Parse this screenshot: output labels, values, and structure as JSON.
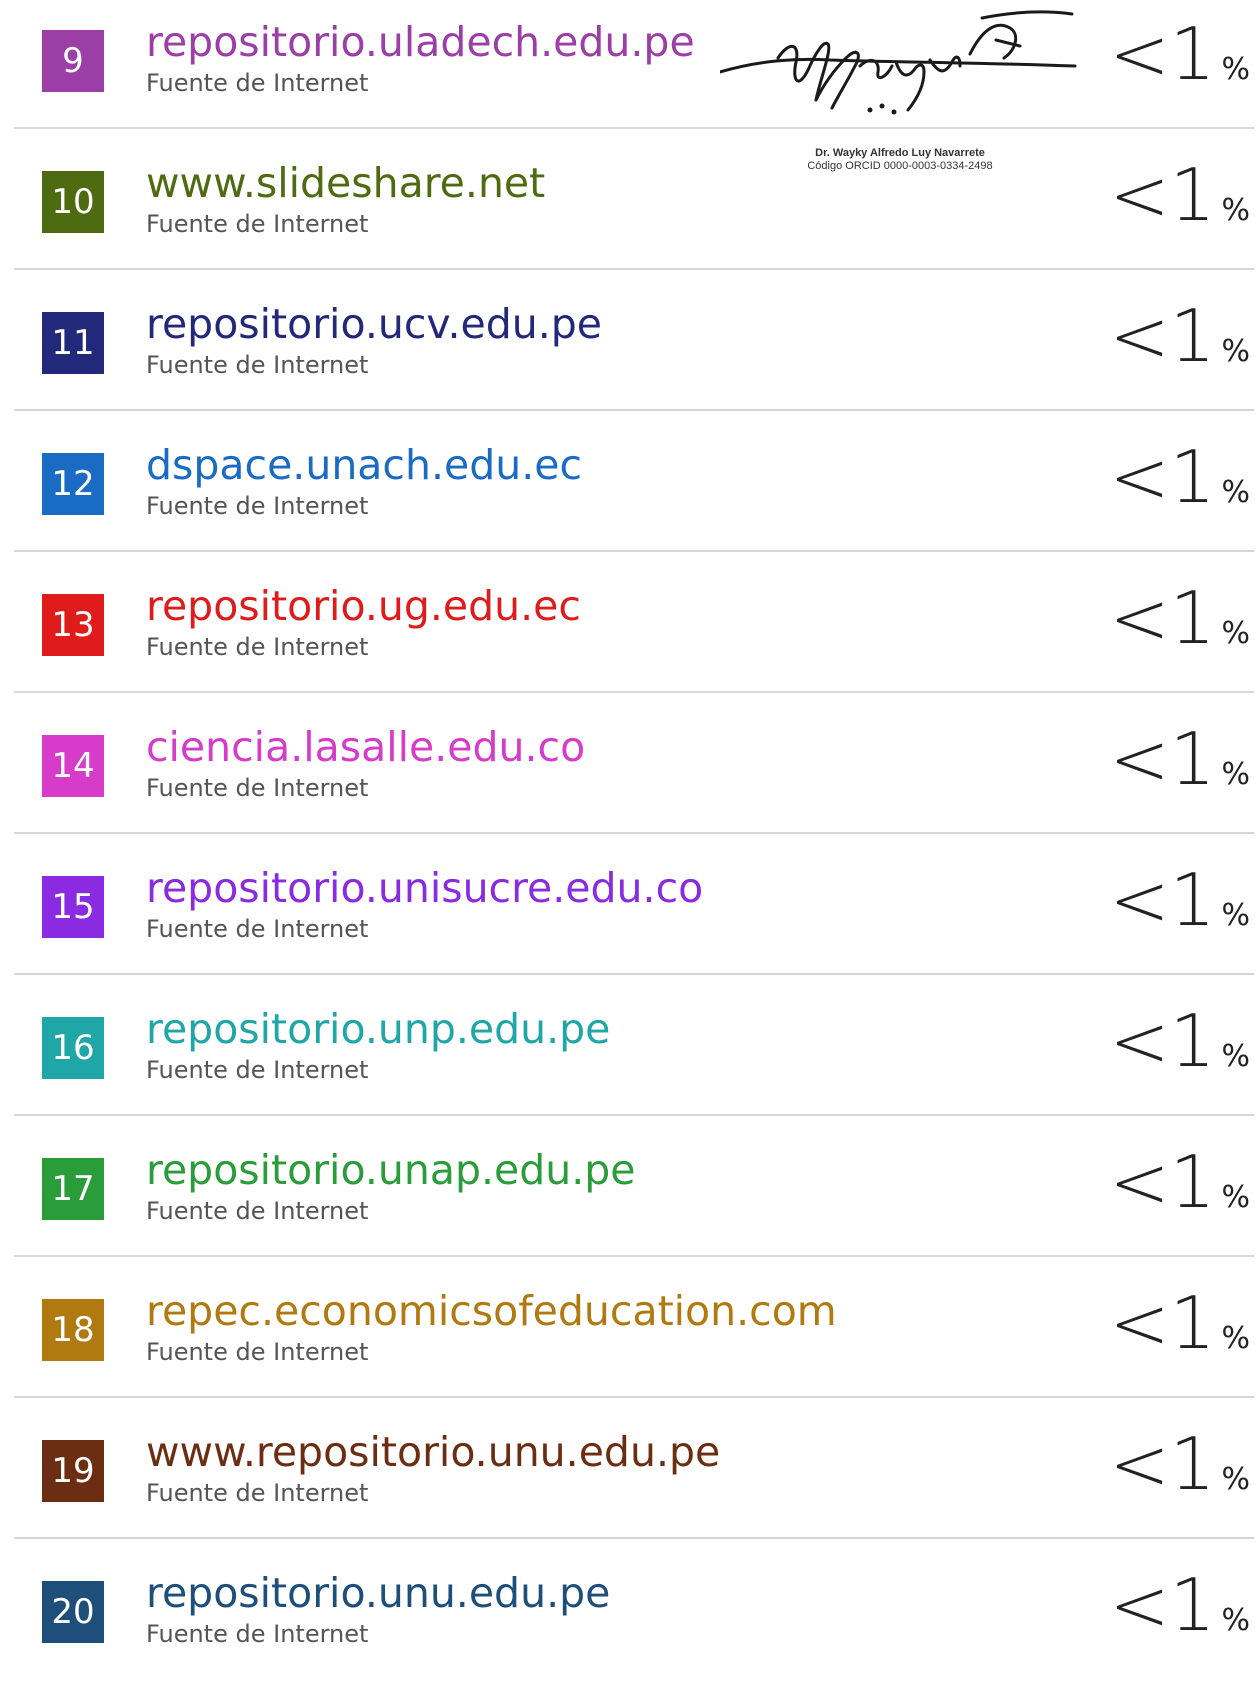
{
  "sources": [
    {
      "num": "9",
      "name": "repositorio.uladech.edu.pe",
      "subtitle": "Fuente de Internet",
      "percent": "<1",
      "percent_sign": "%",
      "color": "#9b3fa6"
    },
    {
      "num": "10",
      "name": "www.slideshare.net",
      "subtitle": "Fuente de Internet",
      "percent": "<1",
      "percent_sign": "%",
      "color": "#4f6b12"
    },
    {
      "num": "11",
      "name": "repositorio.ucv.edu.pe",
      "subtitle": "Fuente de Internet",
      "percent": "<1",
      "percent_sign": "%",
      "color": "#22287a"
    },
    {
      "num": "12",
      "name": "dspace.unach.edu.ec",
      "subtitle": "Fuente de Internet",
      "percent": "<1",
      "percent_sign": "%",
      "color": "#1a6bc4"
    },
    {
      "num": "13",
      "name": "repositorio.ug.edu.ec",
      "subtitle": "Fuente de Internet",
      "percent": "<1",
      "percent_sign": "%",
      "color": "#e01b1b"
    },
    {
      "num": "14",
      "name": "ciencia.lasalle.edu.co",
      "subtitle": "Fuente de Internet",
      "percent": "<1",
      "percent_sign": "%",
      "color": "#d63cc9"
    },
    {
      "num": "15",
      "name": "repositorio.unisucre.edu.co",
      "subtitle": "Fuente de Internet",
      "percent": "<1",
      "percent_sign": "%",
      "color": "#8a2be2"
    },
    {
      "num": "16",
      "name": "repositorio.unp.edu.pe",
      "subtitle": "Fuente de Internet",
      "percent": "<1",
      "percent_sign": "%",
      "color": "#1fa6a6"
    },
    {
      "num": "17",
      "name": "repositorio.unap.edu.pe",
      "subtitle": "Fuente de Internet",
      "percent": "<1",
      "percent_sign": "%",
      "color": "#2a9d3a"
    },
    {
      "num": "18",
      "name": "repec.economicsofeducation.com",
      "subtitle": "Fuente de Internet",
      "percent": "<1",
      "percent_sign": "%",
      "color": "#b07a10"
    },
    {
      "num": "19",
      "name": "www.repositorio.unu.edu.pe",
      "subtitle": "Fuente de Internet",
      "percent": "<1",
      "percent_sign": "%",
      "color": "#6b2e12"
    },
    {
      "num": "20",
      "name": "repositorio.unu.edu.pe",
      "subtitle": "Fuente de Internet",
      "percent": "<1",
      "percent_sign": "%",
      "color": "#1d4f7a"
    }
  ],
  "signature": {
    "line1": "Dr. Wayky Alfredo Luy Navarrete",
    "line2": "Código ORCID 0000-0003-0334-2498"
  }
}
